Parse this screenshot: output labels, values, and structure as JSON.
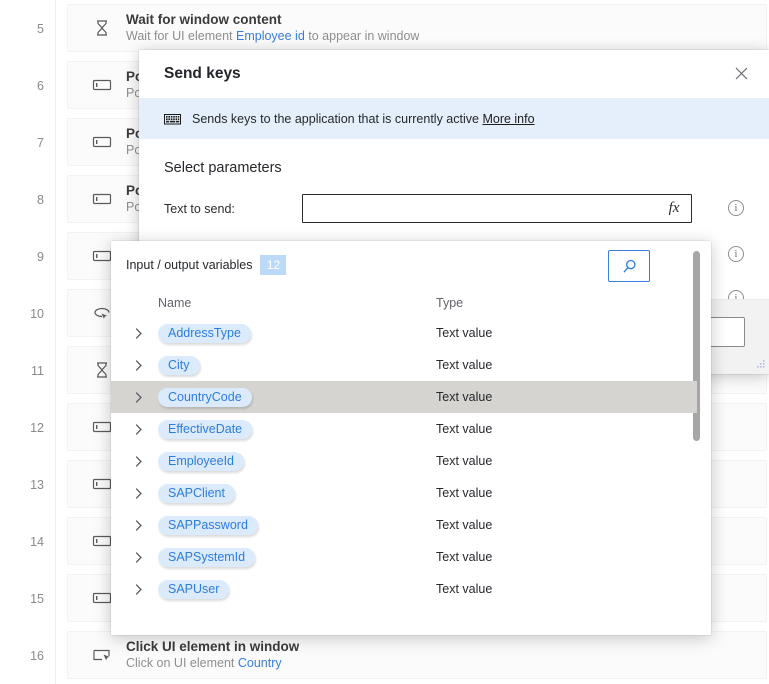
{
  "flow": {
    "rows": [
      {
        "num": "5",
        "icon": "hourglass-icon",
        "title": "Wait for window content",
        "sub_prefix": "Wait for UI element ",
        "sub_link": "Employee id",
        "sub_suffix": " to appear in window"
      },
      {
        "num": "6",
        "icon": "populate-field-icon",
        "title": "Pop",
        "sub_prefix": "Popu",
        "sub_link": "",
        "sub_suffix": ""
      },
      {
        "num": "7",
        "icon": "populate-field-icon",
        "title": "Pop",
        "sub_prefix": "Popu",
        "sub_link": "",
        "sub_suffix": ""
      },
      {
        "num": "8",
        "icon": "populate-field-icon",
        "title": "Pop",
        "sub_prefix": "Popu",
        "sub_link": "",
        "sub_suffix": ""
      },
      {
        "num": "9",
        "icon": "populate-field-icon",
        "title": "",
        "sub_prefix": "",
        "sub_link": "",
        "sub_suffix": ""
      },
      {
        "num": "10",
        "icon": "send-keys-icon",
        "title": "",
        "sub_prefix": "",
        "sub_link": "",
        "sub_suffix": ""
      },
      {
        "num": "11",
        "icon": "hourglass-icon",
        "title": "",
        "sub_prefix": "",
        "sub_link": "",
        "sub_suffix": ""
      },
      {
        "num": "12",
        "icon": "populate-field-icon",
        "title": "",
        "sub_prefix": "",
        "sub_link": "",
        "sub_suffix": ""
      },
      {
        "num": "13",
        "icon": "populate-field-icon",
        "title": "",
        "sub_prefix": "",
        "sub_link": "",
        "sub_suffix": ""
      },
      {
        "num": "14",
        "icon": "populate-field-icon",
        "title": "",
        "sub_prefix": "",
        "sub_link": "",
        "sub_suffix": ""
      },
      {
        "num": "15",
        "icon": "populate-field-icon",
        "title": "",
        "sub_prefix": "",
        "sub_link": "",
        "sub_suffix": ""
      },
      {
        "num": "16",
        "icon": "click-ui-element-icon",
        "title": "Click UI element in window",
        "sub_prefix": "Click on UI element ",
        "sub_link": "Country",
        "sub_suffix": ""
      }
    ]
  },
  "dialog": {
    "title": "Send keys",
    "close_icon": "close-icon",
    "banner": {
      "icon": "keyboard-icon",
      "text": "Sends keys to the application that is currently active",
      "more_info": "More info"
    },
    "section_title": "Select parameters",
    "param": {
      "label": "Text to send:",
      "value": "",
      "placeholder": "",
      "fx_label": "fx",
      "fx_icon": "fx-icon",
      "info_icon": "info-icon"
    },
    "info_icons": [
      "info-icon",
      "info-icon",
      "info-icon"
    ],
    "footer": {
      "button_label": "",
      "resize_grip_icon": "resize-grip-icon"
    }
  },
  "variables_panel": {
    "header_label": "Input / output variables",
    "count": "12",
    "search_icon": "search-icon",
    "columns": {
      "name": "Name",
      "type": "Type"
    },
    "rows": [
      {
        "caret": "chevron-right-icon",
        "name": "AddressType",
        "type": "Text value",
        "selected": false
      },
      {
        "caret": "chevron-right-icon",
        "name": "City",
        "type": "Text value",
        "selected": false
      },
      {
        "caret": "chevron-right-icon",
        "name": "CountryCode",
        "type": "Text value",
        "selected": true
      },
      {
        "caret": "chevron-right-icon",
        "name": "EffectiveDate",
        "type": "Text value",
        "selected": false
      },
      {
        "caret": "chevron-right-icon",
        "name": "EmployeeId",
        "type": "Text value",
        "selected": false
      },
      {
        "caret": "chevron-right-icon",
        "name": "SAPClient",
        "type": "Text value",
        "selected": false
      },
      {
        "caret": "chevron-right-icon",
        "name": "SAPPassword",
        "type": "Text value",
        "selected": false
      },
      {
        "caret": "chevron-right-icon",
        "name": "SAPSystemId",
        "type": "Text value",
        "selected": false
      },
      {
        "caret": "chevron-right-icon",
        "name": "SAPUser",
        "type": "Text value",
        "selected": false
      }
    ]
  },
  "colors": {
    "accent": "#2b7de0",
    "banner_bg": "#e5effb",
    "chip_bg": "#dcebfb",
    "selected_row": "#d6d4d1",
    "badge_bg": "#bcd9f7"
  }
}
